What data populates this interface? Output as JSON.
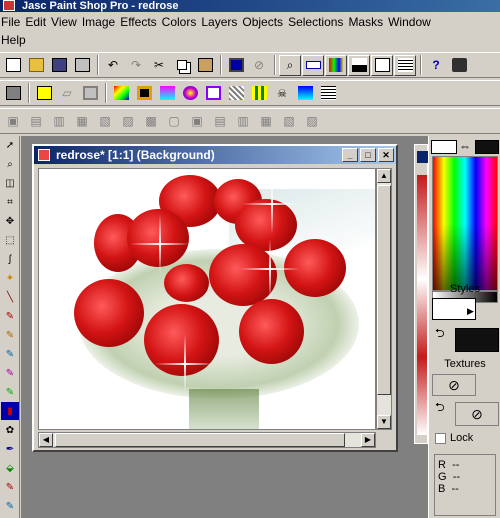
{
  "app": {
    "title": "Jasc Paint Shop Pro - redrose"
  },
  "menu": {
    "row1": [
      "File",
      "Edit",
      "View",
      "Image",
      "Effects",
      "Colors",
      "Layers",
      "Objects",
      "Selections",
      "Masks",
      "Window"
    ],
    "row2": [
      "Help"
    ]
  },
  "image_window": {
    "title": "redrose* [1:1] (Background)"
  },
  "right_panel": {
    "styles_label": "Styles",
    "textures_label": "Textures",
    "lock_label": "Lock",
    "rgb": {
      "r_label": "R",
      "g_label": "G",
      "b_label": "B",
      "r_value": "--",
      "g_value": "--",
      "b_value": "--"
    }
  },
  "colors": {
    "title_start": "#0a246a",
    "title_end": "#a6caf0",
    "face": "#d4d0c8",
    "workspace": "#808080",
    "rose_red": "#d31414"
  }
}
